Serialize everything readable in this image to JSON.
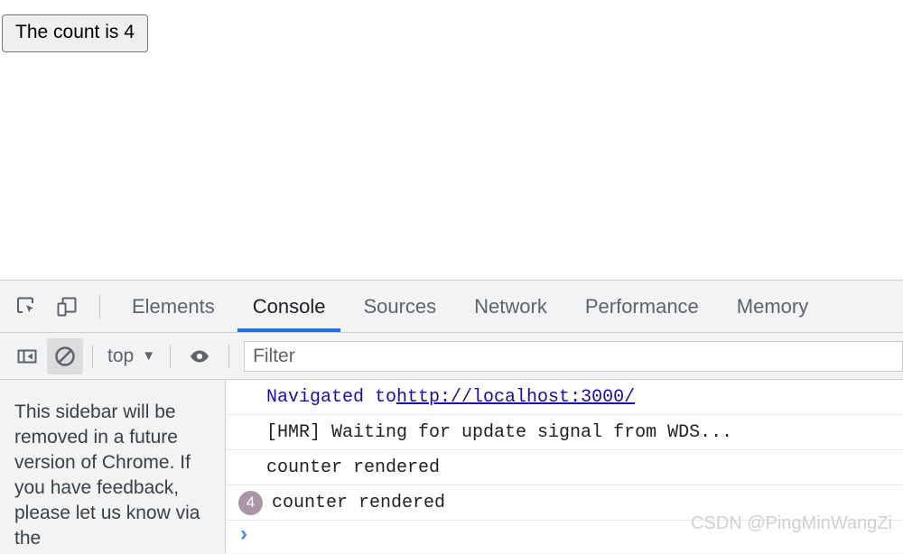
{
  "page": {
    "counter_button_label": "The count is 4"
  },
  "devtools": {
    "toolbar_icons": [
      {
        "name": "inspect-element-icon",
        "title": "Inspect element"
      },
      {
        "name": "device-toolbar-icon",
        "title": "Toggle device toolbar"
      }
    ],
    "panel_tabs": [
      {
        "label": "Elements",
        "active": false
      },
      {
        "label": "Console",
        "active": true
      },
      {
        "label": "Sources",
        "active": false
      },
      {
        "label": "Network",
        "active": false
      },
      {
        "label": "Performance",
        "active": false
      },
      {
        "label": "Memory",
        "active": false
      }
    ],
    "active_tab": "Console",
    "accent_color": "#1a73e8"
  },
  "console_toolbar": {
    "sidebar_toggle_icon": "show-console-sidebar-icon",
    "clear_icon": "clear-console-icon",
    "context_label": "top",
    "context_caret": "▼",
    "eye_icon": "create-live-expression-icon",
    "filter_placeholder": "Filter"
  },
  "console_sidebar": {
    "notice": "This sidebar will be removed in a future version of Chrome. If you have feedback, please let us know via the"
  },
  "console_messages": [
    {
      "type": "navigation",
      "prefix": "Navigated to ",
      "link": "http://localhost:3000/",
      "repeat": null,
      "indent": true
    },
    {
      "type": "log",
      "text": "[HMR] Waiting for update signal from WDS...",
      "repeat": null,
      "indent": true
    },
    {
      "type": "log",
      "text": "counter rendered",
      "repeat": null,
      "indent": true
    },
    {
      "type": "log",
      "text": "counter rendered",
      "repeat": "4",
      "indent": false
    }
  ],
  "console_prompt": {
    "chevron": "›"
  },
  "watermark": {
    "text": "CSDN @PingMinWangZi"
  }
}
